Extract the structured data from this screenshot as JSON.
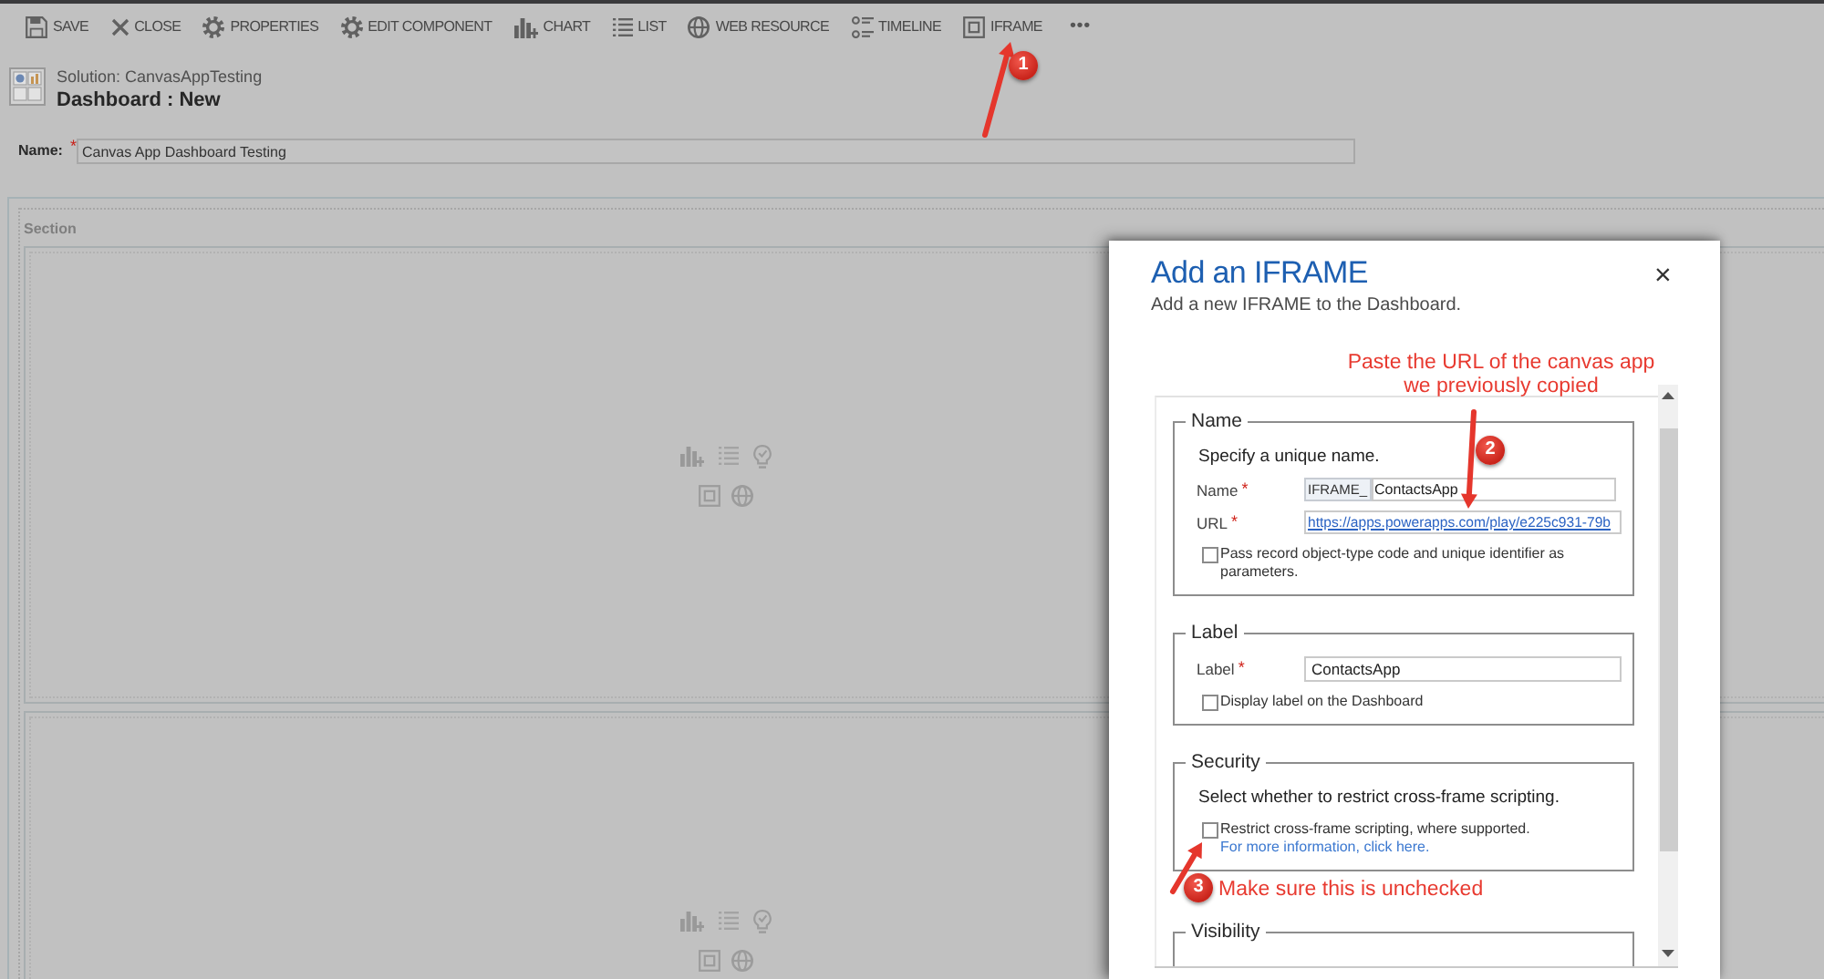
{
  "toolbar": {
    "items": [
      {
        "kind": "save",
        "label": "SAVE"
      },
      {
        "kind": "close",
        "label": "CLOSE"
      },
      {
        "kind": "properties",
        "label": "PROPERTIES"
      },
      {
        "kind": "edit-component",
        "label": "EDIT COMPONENT"
      },
      {
        "kind": "chart",
        "label": "CHART"
      },
      {
        "kind": "list",
        "label": "LIST"
      },
      {
        "kind": "web-resource",
        "label": "WEB RESOURCE"
      },
      {
        "kind": "timeline",
        "label": "TIMELINE"
      },
      {
        "kind": "iframe",
        "label": "IFRAME"
      }
    ],
    "more": "•••"
  },
  "header": {
    "solution": "Solution: CanvasAppTesting",
    "title": "Dashboard : New"
  },
  "name_field": {
    "label": "Name:",
    "required_mark": "*",
    "value": "Canvas App Dashboard Testing"
  },
  "section": {
    "label": "Section",
    "panels": [
      {
        "kind": "empty"
      },
      {
        "kind": "empty"
      }
    ]
  },
  "dialog": {
    "title": "Add an IFRAME",
    "subtitle": "Add a new IFRAME to the Dashboard.",
    "close": "×",
    "groups": [
      {
        "legend": "Name",
        "intro": "Specify a unique name.",
        "fields": [
          {
            "kind": "prefixed",
            "label": "Name",
            "required_mark": "*",
            "prefix": "IFRAME_",
            "value": "ContactsApp"
          },
          {
            "kind": "link",
            "label": "URL",
            "required_mark": "*",
            "value": "https://apps.powerapps.com/play/e225c931-79b"
          }
        ],
        "checkboxes": [
          {
            "label": "Pass record object-type code and unique identifier as parameters.",
            "checked": false
          }
        ]
      },
      {
        "legend": "Label",
        "fields": [
          {
            "kind": "text",
            "label": "Label",
            "required_mark": "*",
            "value": "ContactsApp"
          }
        ],
        "checkboxes": [
          {
            "label": "Display label on the Dashboard",
            "checked": false
          }
        ]
      },
      {
        "legend": "Security",
        "intro": "Select whether to restrict cross-frame scripting.",
        "checkboxes": [
          {
            "label": "Restrict cross-frame scripting, where supported.",
            "checked": false
          }
        ],
        "link": "For more information, click here."
      },
      {
        "legend": "Visibility"
      }
    ]
  },
  "annotations": [
    {
      "number": "1"
    },
    {
      "number": "2",
      "text": "Paste the URL of the canvas app we previously copied"
    },
    {
      "number": "3",
      "text": "Make sure this is unchecked"
    }
  ]
}
